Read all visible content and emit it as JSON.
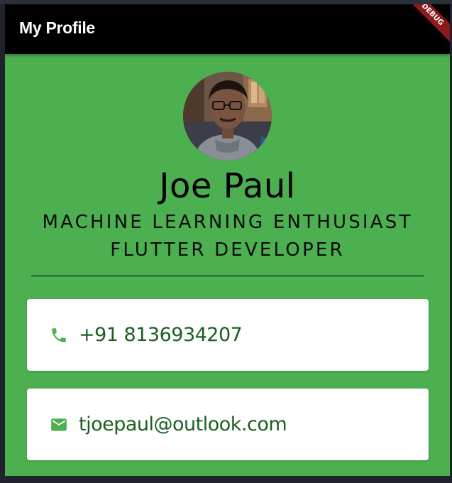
{
  "appbar": {
    "title": "My Profile",
    "debug_label": "DEBUG"
  },
  "profile": {
    "name": "Joe Paul",
    "subtitle_lines": [
      "MACHINE LEARNING ENTHUSIAST",
      "FLUTTER DEVELOPER"
    ]
  },
  "contacts": [
    {
      "icon": "phone-icon",
      "value": "+91 8136934207"
    },
    {
      "icon": "mail-icon",
      "value": "tjoepaul@outlook.com"
    }
  ],
  "colors": {
    "background": "#4caf50",
    "appbar": "#000000",
    "accent": "#4caf50",
    "contact_text": "#1b5e20",
    "debug_banner": "#8b1a1a"
  }
}
